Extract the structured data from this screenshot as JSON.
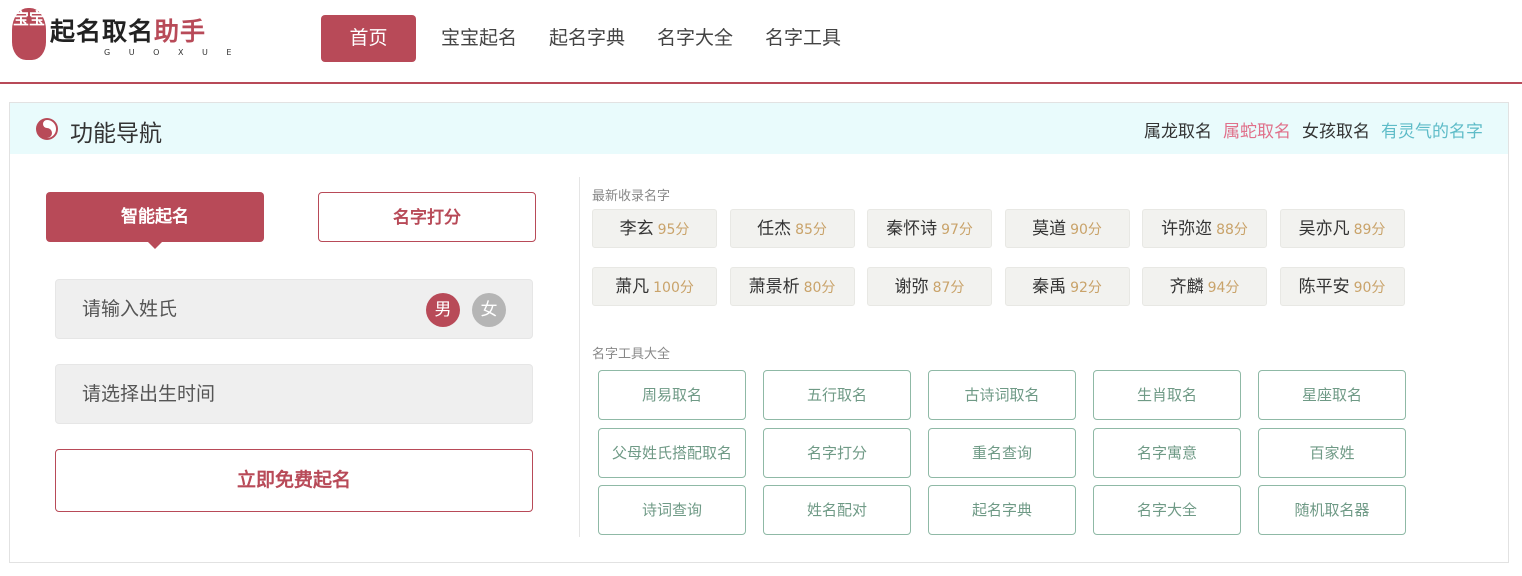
{
  "logo": {
    "seal_text": "宝宝",
    "title_main": "起名取名",
    "title_accent": "助手",
    "subtitle": "G U O X U E"
  },
  "nav": [
    {
      "label": "首页",
      "active": true
    },
    {
      "label": "宝宝起名",
      "active": false
    },
    {
      "label": "起名字典",
      "active": false
    },
    {
      "label": "名字大全",
      "active": false
    },
    {
      "label": "名字工具",
      "active": false
    }
  ],
  "panel": {
    "title": "功能导航",
    "head_links": [
      "属龙取名",
      "属蛇取名",
      "女孩取名",
      "有灵气的名字"
    ]
  },
  "form": {
    "tab_smart": "智能起名",
    "tab_score": "名字打分",
    "surname_placeholder": "请输入姓氏",
    "gender_male": "男",
    "gender_female": "女",
    "birth_placeholder": "请选择出生时间",
    "submit": "立即免费起名"
  },
  "latest": {
    "label": "最新收录名字",
    "names": [
      {
        "name": "李玄",
        "score": "95分"
      },
      {
        "name": "任杰",
        "score": "85分"
      },
      {
        "name": "秦怀诗",
        "score": "97分"
      },
      {
        "name": "莫道",
        "score": "90分"
      },
      {
        "name": "许弥迩",
        "score": "88分"
      },
      {
        "name": "吴亦凡",
        "score": "89分"
      },
      {
        "name": "萧凡",
        "score": "100分"
      },
      {
        "name": "萧景析",
        "score": "80分"
      },
      {
        "name": "谢弥",
        "score": "87分"
      },
      {
        "name": "秦禹",
        "score": "92分"
      },
      {
        "name": "齐麟",
        "score": "94分"
      },
      {
        "name": "陈平安",
        "score": "90分"
      }
    ]
  },
  "tools": {
    "label": "名字工具大全",
    "items": [
      "周易取名",
      "五行取名",
      "古诗词取名",
      "生肖取名",
      "星座取名",
      "父母姓氏搭配取名",
      "名字打分",
      "重名查询",
      "名字寓意",
      "百家姓",
      "诗词查询",
      "姓名配对",
      "起名字典",
      "名字大全",
      "随机取名器"
    ]
  },
  "colors": {
    "brand": "#b84a58",
    "head_bg": "#e9fbfc",
    "score": "#c9a36a",
    "tool_border": "#8fb9a6"
  }
}
